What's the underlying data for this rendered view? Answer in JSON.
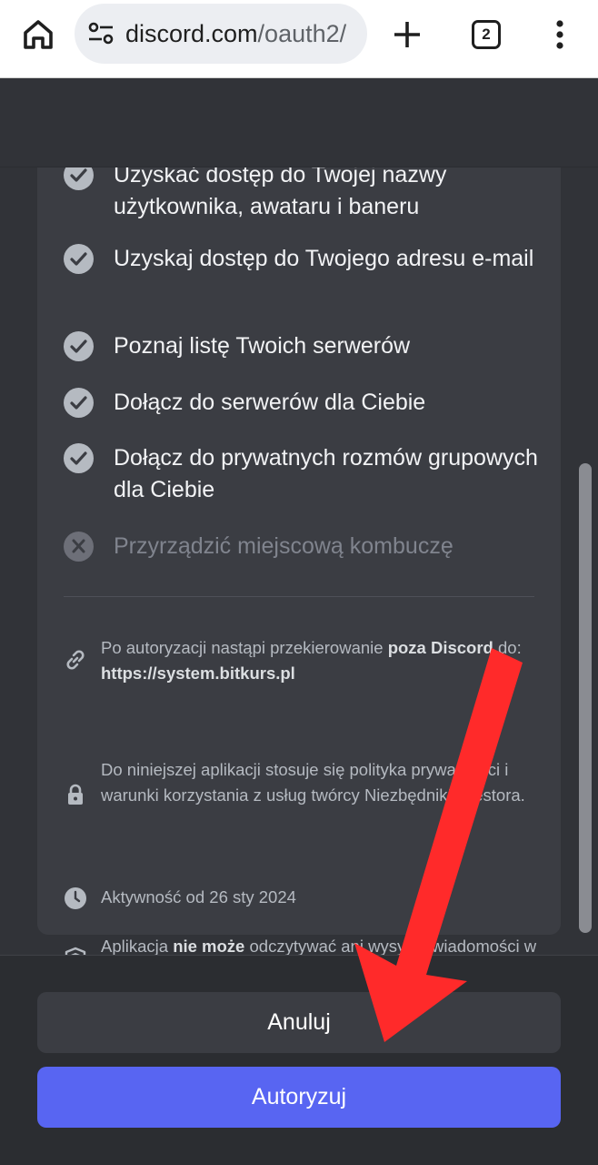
{
  "browser": {
    "url_host": "discord.com",
    "url_path": "/oauth2/",
    "tab_count": "2"
  },
  "scopes": [
    {
      "text": "Uzyskać dostęp do Twojej nazwy użytkownika, awataru i baneru",
      "allowed": true
    },
    {
      "text": "Uzyskaj dostęp do Twojego adresu e-mail",
      "allowed": true
    },
    {
      "text": "Poznaj listę Twoich serwerów",
      "allowed": true
    },
    {
      "text": "Dołącz do serwerów dla Ciebie",
      "allowed": true
    },
    {
      "text": "Dołącz do prywatnych rozmów grupowych dla Ciebie",
      "allowed": true
    },
    {
      "text": "Przyrządzić miejscową kombuczę",
      "allowed": false
    }
  ],
  "info": {
    "redirect_prefix": "Po autoryzacji nastąpi przekierowanie ",
    "redirect_bold": "poza Discord",
    "redirect_mid": " do: ",
    "redirect_url": "https://system.bitkurs.pl",
    "policy": "Do niniejszej aplikacji stosuje się polityka prywatności i warunki korzystania z usług twórcy NiezbędnikInwestora.",
    "active_since": "Aktywność od 26 sty 2024",
    "messages_prefix": "Aplikacja ",
    "messages_bold": "nie może",
    "messages_suffix": " odczytywać ani wysyłać wiadomości w Twoim imieniu."
  },
  "buttons": {
    "cancel": "Anuluj",
    "authorize": "Autoryzuj"
  },
  "colors": {
    "accent": "#5865f2",
    "annotation_arrow": "#ff2a2a"
  },
  "icons": [
    "home-icon",
    "site-settings-icon",
    "plus-icon",
    "tab-switcher-icon",
    "more-vert-icon",
    "check-icon",
    "x-icon",
    "link-icon",
    "lock-icon",
    "clock-icon",
    "shield-icon"
  ]
}
